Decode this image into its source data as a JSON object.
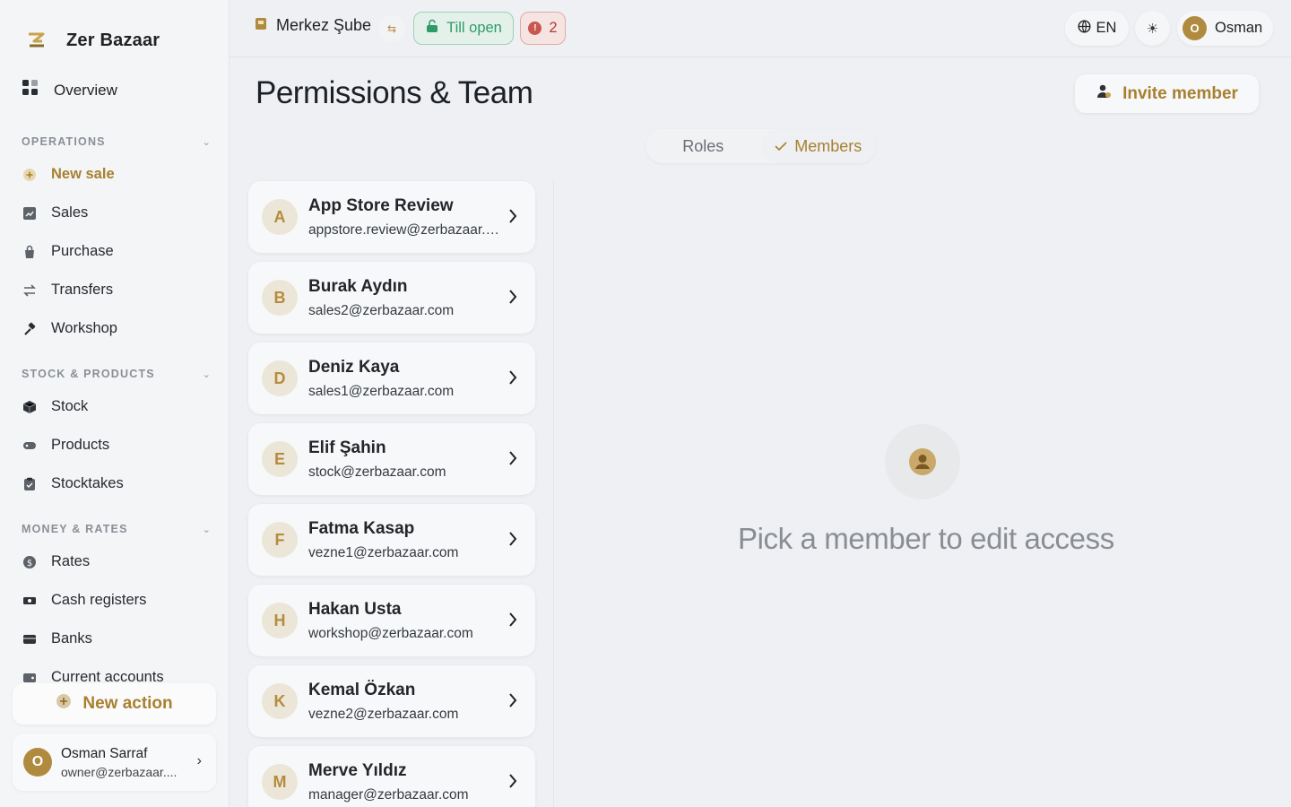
{
  "app": {
    "name": "Zer Bazaar"
  },
  "sidebar": {
    "overview": "Overview",
    "sections": [
      {
        "title": "OPERATIONS",
        "items": [
          {
            "label": "New sale",
            "icon": "plus-circle-icon",
            "active": true
          },
          {
            "label": "Sales",
            "icon": "chart-icon"
          },
          {
            "label": "Purchase",
            "icon": "bag-icon"
          },
          {
            "label": "Transfers",
            "icon": "transfer-icon"
          },
          {
            "label": "Workshop",
            "icon": "hammer-icon"
          }
        ]
      },
      {
        "title": "STOCK & PRODUCTS",
        "items": [
          {
            "label": "Stock",
            "icon": "box-icon"
          },
          {
            "label": "Products",
            "icon": "tag-icon"
          },
          {
            "label": "Stocktakes",
            "icon": "clipboard-icon"
          }
        ]
      },
      {
        "title": "MONEY & RATES",
        "items": [
          {
            "label": "Rates",
            "icon": "dollar-icon"
          },
          {
            "label": "Cash registers",
            "icon": "cash-icon"
          },
          {
            "label": "Banks",
            "icon": "bank-icon"
          },
          {
            "label": "Current accounts",
            "icon": "wallet-icon"
          }
        ]
      }
    ],
    "new_action": "New action",
    "user": {
      "initial": "O",
      "name": "Osman Sarraf",
      "email": "owner@zerbazaar...."
    }
  },
  "topbar": {
    "branch": "Merkez Şube",
    "till": "Till open",
    "alerts_count": "2",
    "language": "EN",
    "profile": {
      "initial": "O",
      "name": "Osman"
    }
  },
  "main": {
    "title": "Permissions & Team",
    "invite_label": "Invite member",
    "tabs": [
      {
        "label": "Roles",
        "active": false
      },
      {
        "label": "Members",
        "active": true
      }
    ],
    "members": [
      {
        "initial": "A",
        "name": "App Store Review",
        "email": "appstore.review@zerbazaar.com"
      },
      {
        "initial": "B",
        "name": "Burak Aydın",
        "email": "sales2@zerbazaar.com"
      },
      {
        "initial": "D",
        "name": "Deniz Kaya",
        "email": "sales1@zerbazaar.com"
      },
      {
        "initial": "E",
        "name": "Elif Şahin",
        "email": "stock@zerbazaar.com"
      },
      {
        "initial": "F",
        "name": "Fatma Kasap",
        "email": "vezne1@zerbazaar.com"
      },
      {
        "initial": "H",
        "name": "Hakan Usta",
        "email": "workshop@zerbazaar.com"
      },
      {
        "initial": "K",
        "name": "Kemal Özkan",
        "email": "vezne2@zerbazaar.com"
      },
      {
        "initial": "M",
        "name": "Merve Yıldız",
        "email": "manager@zerbazaar.com"
      }
    ],
    "empty_state": "Pick a member to edit access"
  },
  "colors": {
    "accent": "#a8802f",
    "success": "#2f9b68",
    "danger": "#b43a32"
  }
}
